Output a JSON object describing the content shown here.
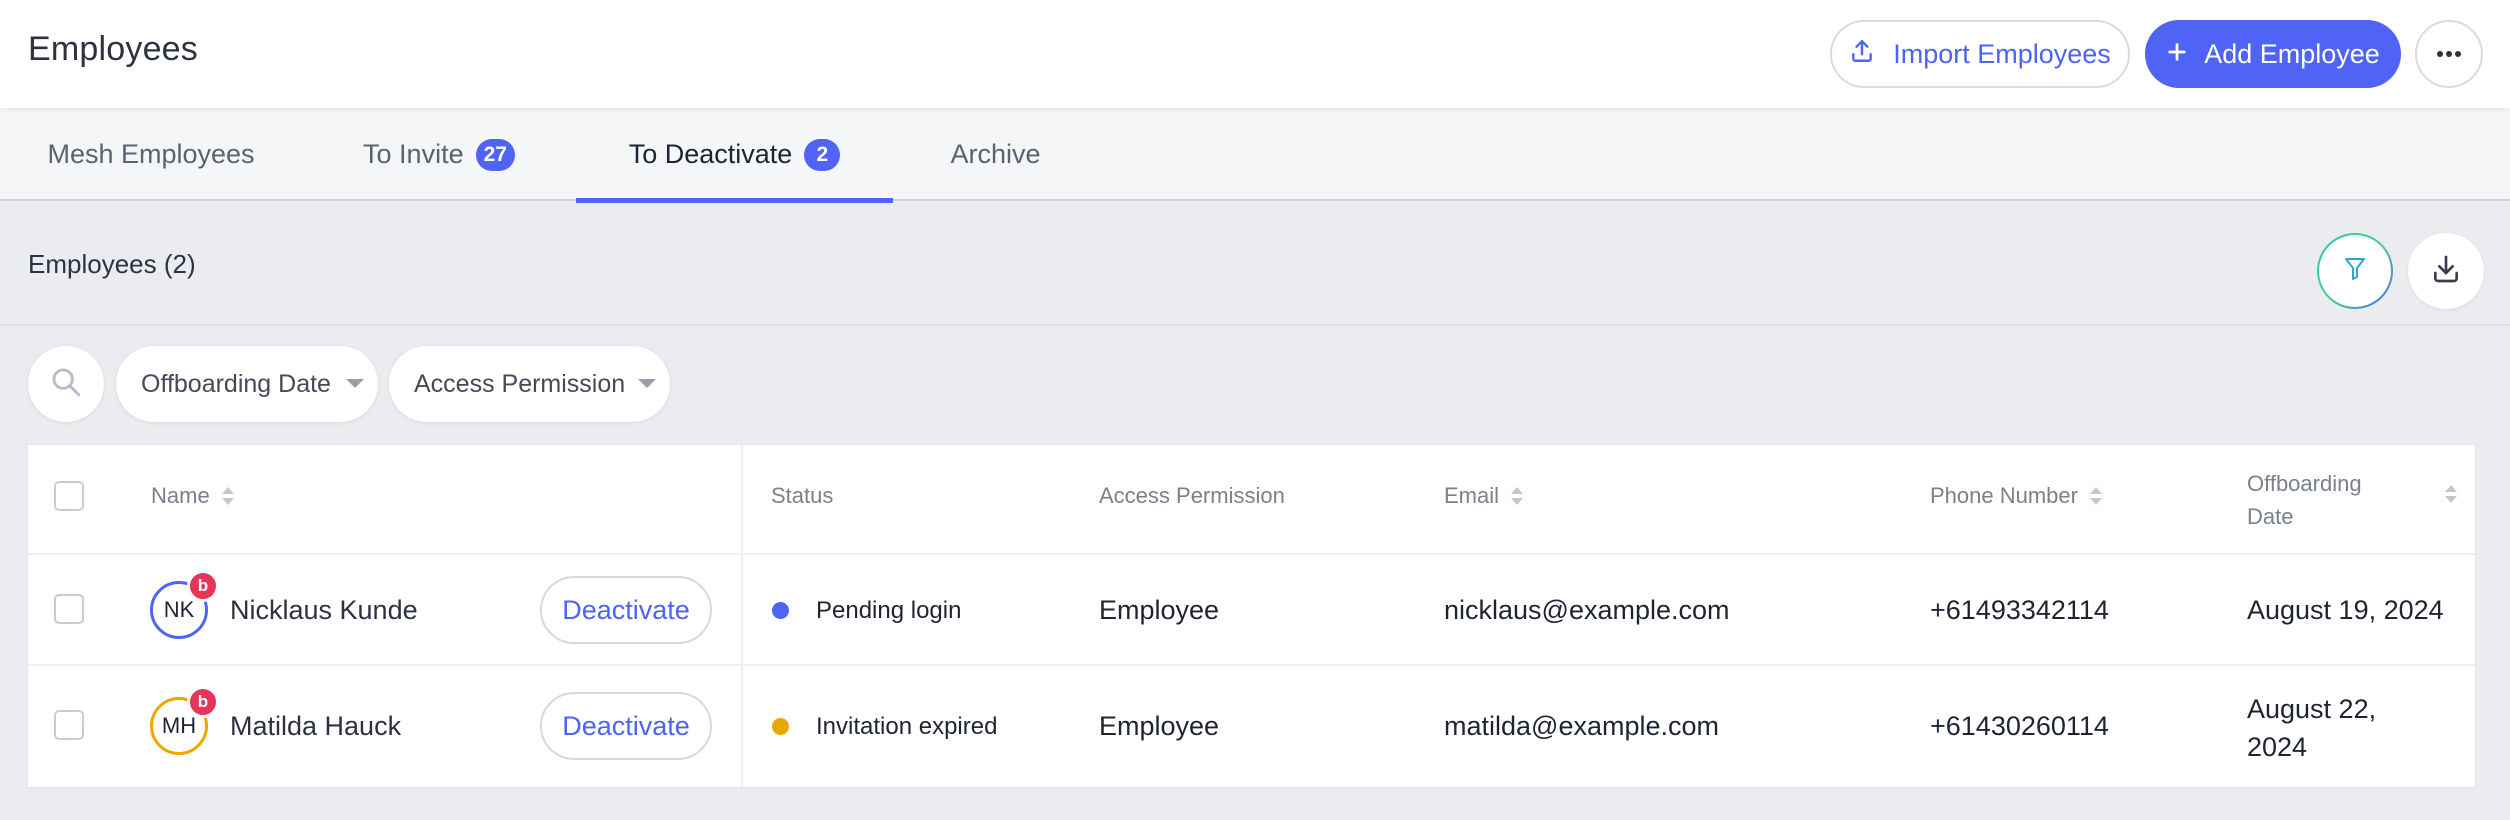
{
  "header": {
    "title": "Employees",
    "import_label": "Import Employees",
    "add_label": "Add Employee"
  },
  "tabs": [
    {
      "label": "Mesh Employees",
      "count": null
    },
    {
      "label": "To Invite",
      "count": "27"
    },
    {
      "label": "To Deactivate",
      "count": "2",
      "active": true
    },
    {
      "label": "Archive",
      "count": null
    }
  ],
  "section": {
    "title": "Employees (2)"
  },
  "filters": {
    "offboarding_label": "Offboarding Date",
    "access_label": "Access Permission"
  },
  "table": {
    "headers": {
      "name": "Name",
      "status": "Status",
      "access": "Access Permission",
      "email": "Email",
      "phone": "Phone Number",
      "offboarding_line1": "Offboarding",
      "offboarding_line2": "Date"
    },
    "rows": [
      {
        "initials": "NK",
        "badge": "b",
        "name": "Nicklaus Kunde",
        "action": "Deactivate",
        "status": "Pending login",
        "status_color": "#4f63f5",
        "access": "Employee",
        "email": "nicklaus@example.com",
        "phone": "+61493342114",
        "offboarding": "August 19, 2024"
      },
      {
        "initials": "MH",
        "badge": "b",
        "name": "Matilda Hauck",
        "action": "Deactivate",
        "status": "Invitation expired",
        "status_color": "#e6a700",
        "access": "Employee",
        "email": "matilda@example.com",
        "phone": "+61430260114",
        "offboarding_line1": "August 22,",
        "offboarding_line2": "2024"
      }
    ]
  },
  "colors": {
    "accent": "#4f63f5",
    "badge_red": "#e5365a",
    "avatar_orange": "#f0a500"
  },
  "icons": [
    "upload-icon",
    "plus-icon",
    "more-horizontal-icon",
    "filter-icon",
    "download-icon",
    "search-icon"
  ]
}
